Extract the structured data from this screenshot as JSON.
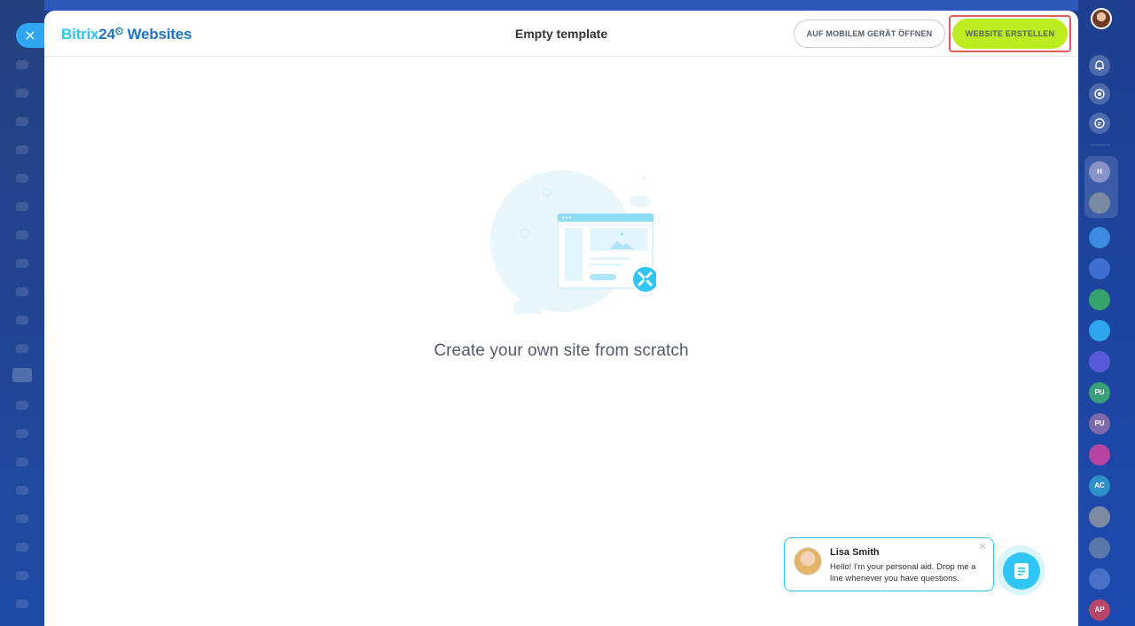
{
  "header": {
    "logo_brand": "Bitrix",
    "logo_num": "24",
    "logo_clock": "⏲",
    "logo_product": " Websites",
    "title": "Empty template",
    "mobile_button": "AUF MOBILEM GERÄT ÖFFNEN",
    "create_button": "WEBSITE ERSTELLEN"
  },
  "close_label": "×",
  "main": {
    "empty_text": "Create your own site from scratch"
  },
  "chat": {
    "name": "Lisa Smith",
    "message": "Hello! I'm your personal aid. Drop me a line whenever you have questions.",
    "close": "×"
  },
  "right_sidebar": {
    "avatars": [
      {
        "label": "H",
        "color": "#8a93c9"
      },
      {
        "label": "",
        "color": "#7b8aa3"
      },
      {
        "label": "",
        "color": "#3c8be0"
      },
      {
        "label": "",
        "color": "#3d6fd1"
      },
      {
        "label": "",
        "color": "#35a36a"
      },
      {
        "label": "",
        "color": "#2fa6f0"
      },
      {
        "label": "",
        "color": "#5a5ad6"
      },
      {
        "label": "PU",
        "color": "#3a9e78"
      },
      {
        "label": "PU",
        "color": "#7a6aa8"
      },
      {
        "label": "",
        "color": "#b545a0"
      },
      {
        "label": "AC",
        "color": "#2f8fc9"
      },
      {
        "label": "",
        "color": "#7e8aa0"
      },
      {
        "label": "",
        "color": "#5b76a8"
      },
      {
        "label": "",
        "color": "#4b70c8"
      },
      {
        "label": "AP",
        "color": "#b8476a"
      }
    ]
  },
  "colors": {
    "accent_green": "#bbed21",
    "highlight_red": "#e25b5b",
    "brand_blue": "#2fc6f6"
  }
}
